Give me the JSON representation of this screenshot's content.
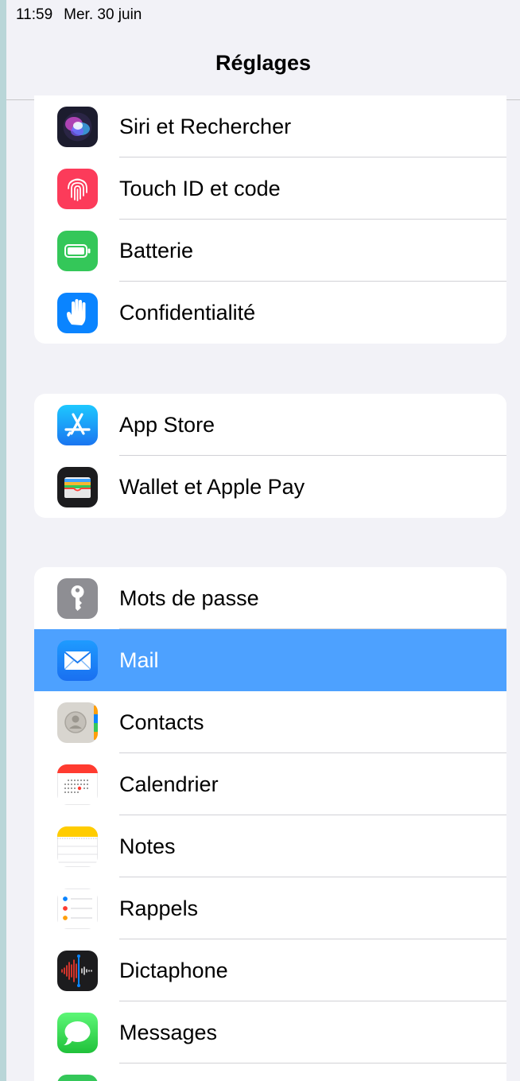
{
  "status_bar": {
    "time": "11:59",
    "date": "Mer. 30 juin"
  },
  "nav": {
    "title": "Réglages"
  },
  "groups": [
    {
      "items": [
        {
          "label": "Siri et Rechercher",
          "icon": "siri-icon"
        },
        {
          "label": "Touch ID et code",
          "icon": "fingerprint-icon"
        },
        {
          "label": "Batterie",
          "icon": "battery-icon"
        },
        {
          "label": "Confidentialité",
          "icon": "privacy-hand-icon"
        }
      ]
    },
    {
      "items": [
        {
          "label": "App Store",
          "icon": "app-store-icon"
        },
        {
          "label": "Wallet et Apple Pay",
          "icon": "wallet-icon"
        }
      ]
    },
    {
      "items": [
        {
          "label": "Mots de passe",
          "icon": "key-icon"
        },
        {
          "label": "Mail",
          "icon": "mail-envelope-icon",
          "selected": true
        },
        {
          "label": "Contacts",
          "icon": "contacts-icon"
        },
        {
          "label": "Calendrier",
          "icon": "calendar-icon"
        },
        {
          "label": "Notes",
          "icon": "notes-icon"
        },
        {
          "label": "Rappels",
          "icon": "reminders-icon"
        },
        {
          "label": "Dictaphone",
          "icon": "voice-memos-icon"
        },
        {
          "label": "Messages",
          "icon": "messages-icon"
        }
      ]
    }
  ],
  "colors": {
    "selected_row": "#4da1ff",
    "background": "#f2f2f7",
    "separator": "#d1d1d6"
  }
}
